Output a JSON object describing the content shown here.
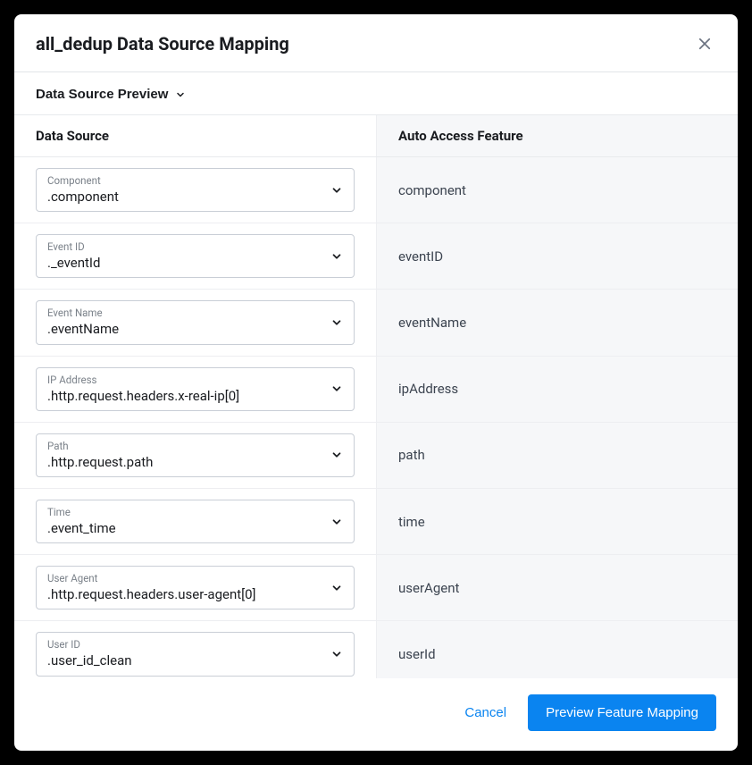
{
  "modal": {
    "title": "all_dedup Data Source Mapping",
    "previewLabel": "Data Source Preview"
  },
  "columns": {
    "left": "Data Source",
    "right": "Auto Access Feature"
  },
  "rows": [
    {
      "label": "Component",
      "value": ".component",
      "feature": "component"
    },
    {
      "label": "Event ID",
      "value": "._eventId",
      "feature": "eventID"
    },
    {
      "label": "Event Name",
      "value": ".eventName",
      "feature": "eventName"
    },
    {
      "label": "IP Address",
      "value": ".http.request.headers.x-real-ip[0]",
      "feature": "ipAddress"
    },
    {
      "label": "Path",
      "value": ".http.request.path",
      "feature": "path"
    },
    {
      "label": "Time",
      "value": ".event_time",
      "feature": "time"
    },
    {
      "label": "User Agent",
      "value": ".http.request.headers.user-agent[0]",
      "feature": "userAgent"
    },
    {
      "label": "User ID",
      "value": ".user_id_clean",
      "feature": "userId"
    }
  ],
  "footer": {
    "cancel": "Cancel",
    "primary": "Preview Feature Mapping"
  }
}
